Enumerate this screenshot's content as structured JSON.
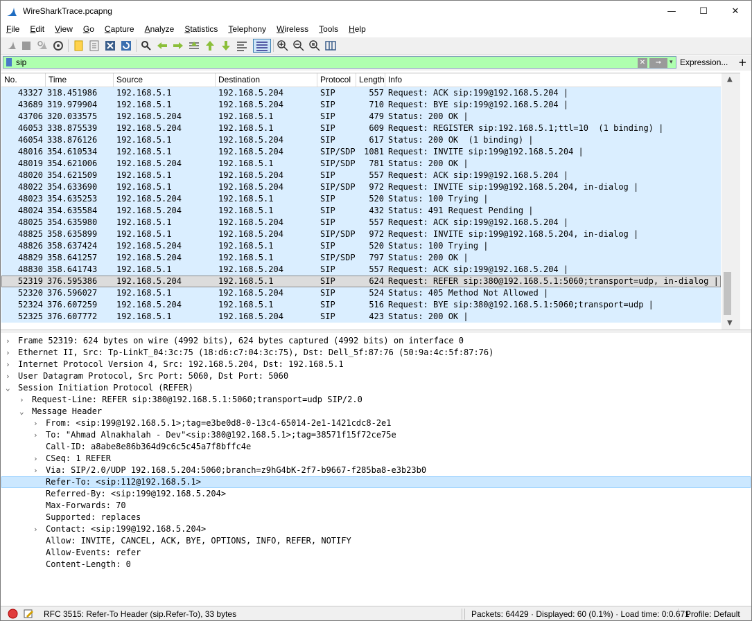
{
  "window": {
    "title": "WireSharkTrace.pcapng",
    "minimize": "—",
    "maximize": "☐",
    "close": "✕"
  },
  "menu": [
    "File",
    "Edit",
    "View",
    "Go",
    "Capture",
    "Analyze",
    "Statistics",
    "Telephony",
    "Wireless",
    "Tools",
    "Help"
  ],
  "filter": {
    "value": "sip",
    "expression_label": "Expression...",
    "add_label": "+"
  },
  "columns": [
    "No.",
    "Time",
    "Source",
    "Destination",
    "Protocol",
    "Length",
    "Info"
  ],
  "packets": [
    {
      "no": "43327",
      "time": "318.451986",
      "src": "192.168.5.1",
      "dst": "192.168.5.204",
      "proto": "SIP",
      "len": "557",
      "info": "Request: ACK sip:199@192.168.5.204 |"
    },
    {
      "no": "43689",
      "time": "319.979904",
      "src": "192.168.5.1",
      "dst": "192.168.5.204",
      "proto": "SIP",
      "len": "710",
      "info": "Request: BYE sip:199@192.168.5.204 |"
    },
    {
      "no": "43706",
      "time": "320.033575",
      "src": "192.168.5.204",
      "dst": "192.168.5.1",
      "proto": "SIP",
      "len": "479",
      "info": "Status: 200 OK |"
    },
    {
      "no": "46053",
      "time": "338.875539",
      "src": "192.168.5.204",
      "dst": "192.168.5.1",
      "proto": "SIP",
      "len": "609",
      "info": "Request: REGISTER sip:192.168.5.1;ttl=10  (1 binding) |"
    },
    {
      "no": "46054",
      "time": "338.876126",
      "src": "192.168.5.1",
      "dst": "192.168.5.204",
      "proto": "SIP",
      "len": "617",
      "info": "Status: 200 OK  (1 binding) |"
    },
    {
      "no": "48016",
      "time": "354.610534",
      "src": "192.168.5.1",
      "dst": "192.168.5.204",
      "proto": "SIP/SDP",
      "len": "1081",
      "info": "Request: INVITE sip:199@192.168.5.204 |"
    },
    {
      "no": "48019",
      "time": "354.621006",
      "src": "192.168.5.204",
      "dst": "192.168.5.1",
      "proto": "SIP/SDP",
      "len": "781",
      "info": "Status: 200 OK |"
    },
    {
      "no": "48020",
      "time": "354.621509",
      "src": "192.168.5.1",
      "dst": "192.168.5.204",
      "proto": "SIP",
      "len": "557",
      "info": "Request: ACK sip:199@192.168.5.204 |"
    },
    {
      "no": "48022",
      "time": "354.633690",
      "src": "192.168.5.1",
      "dst": "192.168.5.204",
      "proto": "SIP/SDP",
      "len": "972",
      "info": "Request: INVITE sip:199@192.168.5.204, in-dialog |"
    },
    {
      "no": "48023",
      "time": "354.635253",
      "src": "192.168.5.204",
      "dst": "192.168.5.1",
      "proto": "SIP",
      "len": "520",
      "info": "Status: 100 Trying |"
    },
    {
      "no": "48024",
      "time": "354.635584",
      "src": "192.168.5.204",
      "dst": "192.168.5.1",
      "proto": "SIP",
      "len": "432",
      "info": "Status: 491 Request Pending |"
    },
    {
      "no": "48025",
      "time": "354.635980",
      "src": "192.168.5.1",
      "dst": "192.168.5.204",
      "proto": "SIP",
      "len": "557",
      "info": "Request: ACK sip:199@192.168.5.204 |"
    },
    {
      "no": "48825",
      "time": "358.635899",
      "src": "192.168.5.1",
      "dst": "192.168.5.204",
      "proto": "SIP/SDP",
      "len": "972",
      "info": "Request: INVITE sip:199@192.168.5.204, in-dialog |"
    },
    {
      "no": "48826",
      "time": "358.637424",
      "src": "192.168.5.204",
      "dst": "192.168.5.1",
      "proto": "SIP",
      "len": "520",
      "info": "Status: 100 Trying |"
    },
    {
      "no": "48829",
      "time": "358.641257",
      "src": "192.168.5.204",
      "dst": "192.168.5.1",
      "proto": "SIP/SDP",
      "len": "797",
      "info": "Status: 200 OK |"
    },
    {
      "no": "48830",
      "time": "358.641743",
      "src": "192.168.5.1",
      "dst": "192.168.5.204",
      "proto": "SIP",
      "len": "557",
      "info": "Request: ACK sip:199@192.168.5.204 |"
    },
    {
      "no": "52319",
      "time": "376.595386",
      "src": "192.168.5.204",
      "dst": "192.168.5.1",
      "proto": "SIP",
      "len": "624",
      "info": "Request: REFER sip:380@192.168.5.1:5060;transport=udp, in-dialog |",
      "selected": true
    },
    {
      "no": "52320",
      "time": "376.596027",
      "src": "192.168.5.1",
      "dst": "192.168.5.204",
      "proto": "SIP",
      "len": "524",
      "info": "Status: 405 Method Not Allowed |"
    },
    {
      "no": "52324",
      "time": "376.607259",
      "src": "192.168.5.204",
      "dst": "192.168.5.1",
      "proto": "SIP",
      "len": "516",
      "info": "Request: BYE sip:380@192.168.5.1:5060;transport=udp |"
    },
    {
      "no": "52325",
      "time": "376.607772",
      "src": "192.168.5.1",
      "dst": "192.168.5.204",
      "proto": "SIP",
      "len": "423",
      "info": "Status: 200 OK |"
    }
  ],
  "details": [
    {
      "level": 0,
      "toggle": "›",
      "text": "Frame 52319: 624 bytes on wire (4992 bits), 624 bytes captured (4992 bits) on interface 0"
    },
    {
      "level": 0,
      "toggle": "›",
      "text": "Ethernet II, Src: Tp-LinkT_04:3c:75 (18:d6:c7:04:3c:75), Dst: Dell_5f:87:76 (50:9a:4c:5f:87:76)"
    },
    {
      "level": 0,
      "toggle": "›",
      "text": "Internet Protocol Version 4, Src: 192.168.5.204, Dst: 192.168.5.1"
    },
    {
      "level": 0,
      "toggle": "›",
      "text": "User Datagram Protocol, Src Port: 5060, Dst Port: 5060"
    },
    {
      "level": 0,
      "toggle": "⌄",
      "text": "Session Initiation Protocol (REFER)"
    },
    {
      "level": 1,
      "toggle": "›",
      "text": "Request-Line: REFER sip:380@192.168.5.1:5060;transport=udp SIP/2.0"
    },
    {
      "level": 1,
      "toggle": "⌄",
      "text": "Message Header"
    },
    {
      "level": 2,
      "toggle": "›",
      "text": "From: <sip:199@192.168.5.1>;tag=e3be0d8-0-13c4-65014-2e1-1421cdc8-2e1"
    },
    {
      "level": 2,
      "toggle": "›",
      "text": "To: \"Ahmad Alnakhalah - Dev\"<sip:380@192.168.5.1>;tag=38571f15f72ce75e"
    },
    {
      "level": 2,
      "toggle": "",
      "text": "Call-ID: a8abe8e86b364d9c6c5c45a7f8bffc4e"
    },
    {
      "level": 2,
      "toggle": "›",
      "text": "CSeq: 1 REFER"
    },
    {
      "level": 2,
      "toggle": "›",
      "text": "Via: SIP/2.0/UDP 192.168.5.204:5060;branch=z9hG4bK-2f7-b9667-f285ba8-e3b23b0"
    },
    {
      "level": 2,
      "toggle": "",
      "text": "Refer-To: <sip:112@192.168.5.1>",
      "selected": true
    },
    {
      "level": 2,
      "toggle": "",
      "text": "Referred-By: <sip:199@192.168.5.204>"
    },
    {
      "level": 2,
      "toggle": "",
      "text": "Max-Forwards: 70"
    },
    {
      "level": 2,
      "toggle": "",
      "text": "Supported: replaces"
    },
    {
      "level": 2,
      "toggle": "›",
      "text": "Contact: <sip:199@192.168.5.204>"
    },
    {
      "level": 2,
      "toggle": "",
      "text": "Allow: INVITE, CANCEL, ACK, BYE, OPTIONS, INFO, REFER, NOTIFY"
    },
    {
      "level": 2,
      "toggle": "",
      "text": "Allow-Events: refer"
    },
    {
      "level": 2,
      "toggle": "",
      "text": "Content-Length: 0"
    }
  ],
  "status": {
    "field_info": "RFC 3515: Refer-To Header (sip.Refer-To), 33 bytes",
    "packets": "Packets: 64429 · Displayed: 60 (0.1%) · Load time: 0:0.671",
    "profile": "Profile: Default"
  },
  "colors": {
    "row_bg": "#daeeff",
    "filter_ok": "#afffaf",
    "selected_detail": "#cce8ff"
  }
}
